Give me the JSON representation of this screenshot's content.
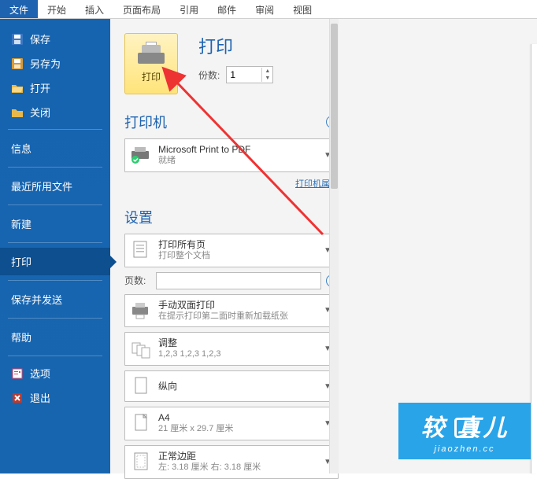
{
  "ribbon": {
    "tabs": [
      "文件",
      "开始",
      "插入",
      "页面布局",
      "引用",
      "邮件",
      "审阅",
      "视图"
    ],
    "active_index": 0
  },
  "sidebar": {
    "quick": [
      {
        "label": "保存",
        "icon": "save-icon"
      },
      {
        "label": "另存为",
        "icon": "save-as-icon"
      },
      {
        "label": "打开",
        "icon": "open-icon"
      },
      {
        "label": "关闭",
        "icon": "close-doc-icon"
      }
    ],
    "sections": [
      "信息",
      "最近所用文件",
      "新建",
      "打印",
      "保存并发送",
      "帮助"
    ],
    "selected_section": "打印",
    "footer": [
      {
        "label": "选项",
        "icon": "options-icon"
      },
      {
        "label": "退出",
        "icon": "exit-icon"
      }
    ]
  },
  "print": {
    "big_button_label": "打印",
    "title": "打印",
    "copies_label": "份数:",
    "copies_value": "1",
    "printer_section": "打印机",
    "printer_name": "Microsoft Print to PDF",
    "printer_status": "就绪",
    "printer_props": "打印机属性",
    "settings_section": "设置",
    "scope_main": "打印所有页",
    "scope_sub": "打印整个文档",
    "pages_label": "页数:",
    "pages_value": "",
    "duplex_main": "手动双面打印",
    "duplex_sub": "在提示打印第二面时重新加载纸张",
    "collate_main": "调整",
    "collate_sub": "1,2,3    1,2,3    1,2,3",
    "orient_main": "纵向",
    "orient_sub": "",
    "paper_main": "A4",
    "paper_sub": "21 厘米 x 29.7 厘米",
    "margins_main": "正常边距",
    "margins_sub": "左: 3.18 厘米   右: 3.18 厘米"
  },
  "logo": {
    "cn1": "较",
    "cn2": "真",
    "cn3": "儿",
    "py": "jiaozhen.cc"
  }
}
